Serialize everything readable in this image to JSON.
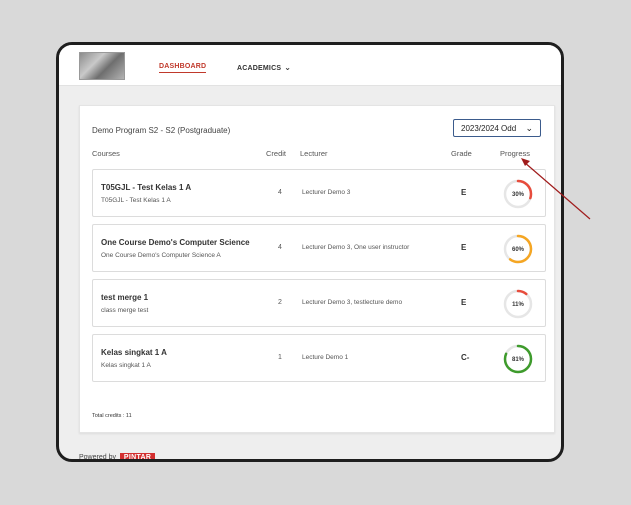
{
  "nav": {
    "dashboard": "DASHBOARD",
    "academics": "ACADEMICS"
  },
  "program": "Demo Program S2 - S2 (Postgraduate)",
  "year_select": {
    "value": "2023/2024 Odd"
  },
  "headers": {
    "courses": "Courses",
    "credit": "Credit",
    "lecturer": "Lecturer",
    "grade": "Grade",
    "progress": "Progress"
  },
  "courses": [
    {
      "title": "T05GJL - Test Kelas 1 A",
      "subtitle": "T05GJL - Test Kelas 1 A",
      "credit": "4",
      "lecturer": "Lecturer Demo 3",
      "grade": "E",
      "progress": 30,
      "progress_label": "30%",
      "color": "#e74c3c"
    },
    {
      "title": "One Course Demo's Computer Science",
      "subtitle": "One Course Demo's Computer Science A",
      "credit": "4",
      "lecturer": "Lecturer Demo 3, One user instructor",
      "grade": "E",
      "progress": 60,
      "progress_label": "60%",
      "color": "#f5a623"
    },
    {
      "title": "test merge 1",
      "subtitle": "class merge test",
      "credit": "2",
      "lecturer": "Lecturer Demo 3, testlecture demo",
      "grade": "E",
      "progress": 11,
      "progress_label": "11%",
      "color": "#e74c3c"
    },
    {
      "title": "Kelas singkat 1 A",
      "subtitle": "Kelas singkat 1 A",
      "credit": "1",
      "lecturer": "Lecture Demo 1",
      "grade": "C-",
      "progress": 81,
      "progress_label": "81%",
      "color": "#3e9b2c"
    }
  ],
  "total_credits": "Total credits : 11",
  "footer": {
    "powered_by": "Powered by",
    "brand": "PINTAR"
  },
  "colors": {
    "accent": "#c0392b",
    "annotation_arrow": "#a01c1c"
  }
}
